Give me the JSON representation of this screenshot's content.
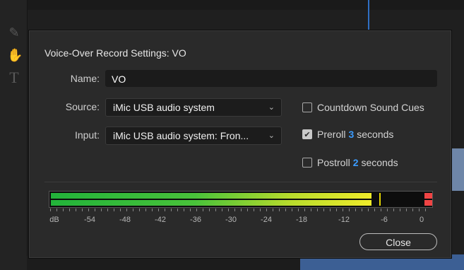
{
  "dialog": {
    "title": "Voice-Over Record Settings: VO",
    "name_label": "Name:",
    "name_value": "VO",
    "source_label": "Source:",
    "source_value": "iMic USB audio system",
    "input_label": "Input:",
    "input_value": "iMic USB audio system: Fron...",
    "countdown": {
      "label": "Countdown Sound Cues",
      "checked": false
    },
    "preroll": {
      "prefix": "Preroll",
      "value": "3",
      "suffix": "seconds",
      "checked": true
    },
    "postroll": {
      "prefix": "Postroll",
      "value": "2",
      "suffix": "seconds",
      "checked": false
    },
    "meter": {
      "scale": [
        "dB",
        "-54",
        "-48",
        "-42",
        "-36",
        "-30",
        "-24",
        "-18",
        "-12",
        "-6",
        "0"
      ],
      "level_fraction": 0.84,
      "peak_fraction": 0.865,
      "clip_indicator": true
    },
    "close_label": "Close"
  },
  "colors": {
    "accent_blue": "#3b9cff",
    "meter_green": "#22b33a",
    "meter_yellow": "#f0ec2a",
    "clip_red": "#f04444"
  },
  "icons": {
    "toolbar": [
      "pen-icon",
      "hand-icon",
      "type-icon"
    ],
    "select_chevron": "chevron-down-icon",
    "checkbox_check": "check-icon"
  }
}
